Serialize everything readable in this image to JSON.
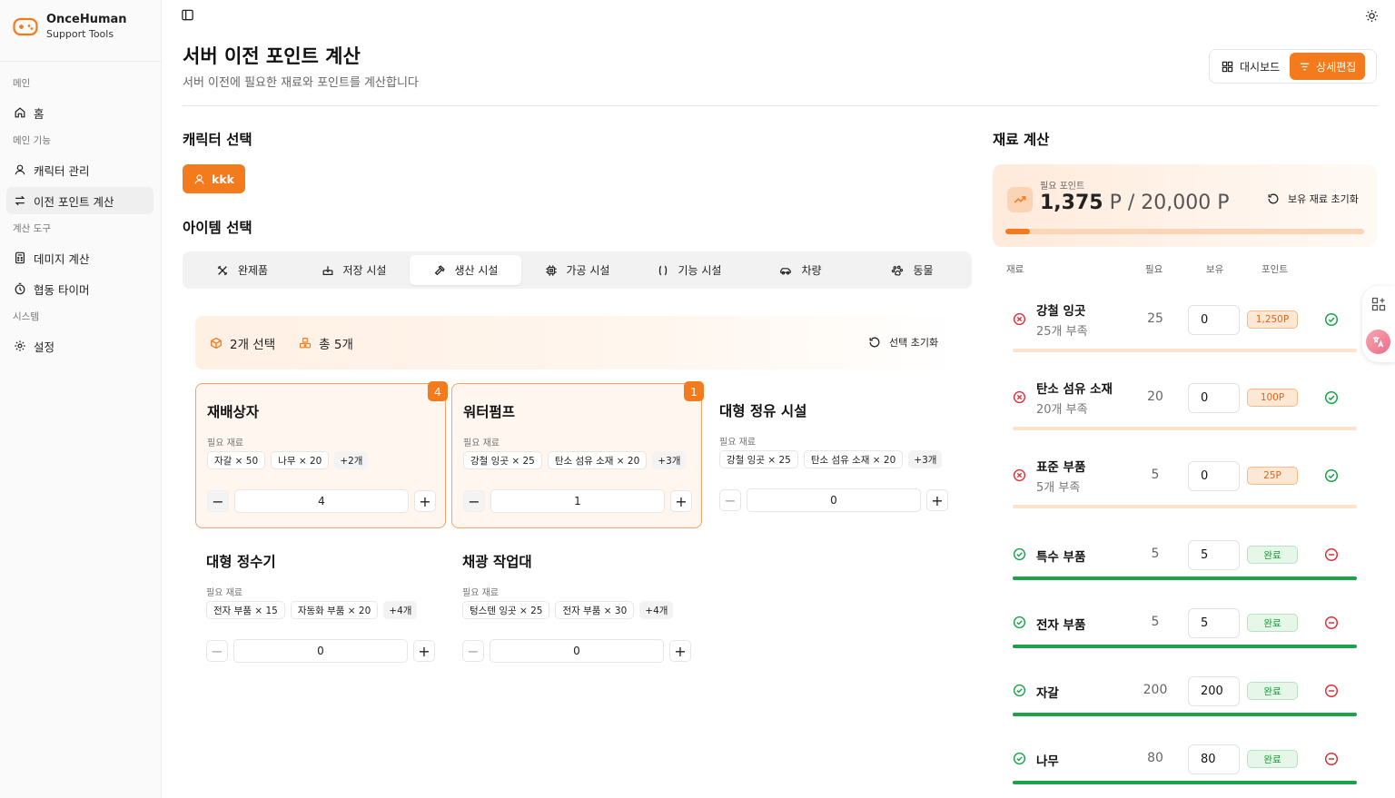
{
  "brand": {
    "name": "OnceHuman",
    "sub": "Support Tools"
  },
  "sidebar": {
    "groups": [
      "메인",
      "메인 기능",
      "계산 도구",
      "시스템"
    ],
    "items": [
      {
        "label": "홈",
        "icon": "home-icon"
      },
      {
        "label": "캐릭터 관리",
        "icon": "user-icon"
      },
      {
        "label": "이전 포인트 계산",
        "icon": "transfer-icon",
        "active": true
      },
      {
        "label": "데미지 계산",
        "icon": "calculator-icon"
      },
      {
        "label": "협동 타이머",
        "icon": "timer-icon"
      },
      {
        "label": "설정",
        "icon": "gear-icon"
      }
    ]
  },
  "header": {
    "title": "서버 이전 포인트 계산",
    "subtitle": "서버 이전에 필요한 재료와 포인트를 계산합니다",
    "dashboard_label": "대시보드",
    "detail_edit_label": "상세편집"
  },
  "character": {
    "section_title": "캐릭터 선택",
    "selected": "kkk"
  },
  "items_section": {
    "section_title": "아이템 선택",
    "tabs": [
      {
        "label": "완제품",
        "icon": "tools-icon"
      },
      {
        "label": "저장 시설",
        "icon": "storage-icon"
      },
      {
        "label": "생산 시설",
        "icon": "hammer-icon",
        "active": true
      },
      {
        "label": "가공 시설",
        "icon": "chip-icon"
      },
      {
        "label": "기능 시설",
        "icon": "brackets-icon"
      },
      {
        "label": "차량",
        "icon": "car-icon"
      },
      {
        "label": "동물",
        "icon": "paw-icon"
      }
    ],
    "summary": {
      "selected_text": "2개 선택",
      "total_text": "총 5개",
      "reset_label": "선택 초기화"
    },
    "req_label": "필요 재료",
    "cards": [
      {
        "name": "재배상자",
        "selected": true,
        "badge": "4",
        "materials": [
          "자갈 × 50",
          "나무 × 20"
        ],
        "more": "+2개",
        "qty": "4"
      },
      {
        "name": "워터펌프",
        "selected": true,
        "badge": "1",
        "materials": [
          "강철 잉곳 × 25",
          "탄소 섬유 소재 × 20"
        ],
        "more": "+3개",
        "qty": "1"
      },
      {
        "name": "대형 정유 시설",
        "selected": false,
        "badge": "",
        "materials": [
          "강철 잉곳 × 25",
          "탄소 섬유 소재 × 20"
        ],
        "more": "+3개",
        "qty": "0"
      },
      {
        "name": "대형 정수기",
        "selected": false,
        "badge": "",
        "materials": [
          "전자 부품 × 15",
          "자동화 부품 × 20"
        ],
        "more": "+4개",
        "qty": "0"
      },
      {
        "name": "채광 작업대",
        "selected": false,
        "badge": "",
        "materials": [
          "텅스텐 잉곳 × 25",
          "전자 부품 × 30"
        ],
        "more": "+4개",
        "qty": "0"
      }
    ]
  },
  "materials_panel": {
    "section_title": "재료 계산",
    "points_label": "필요 포인트",
    "points_current": "1,375",
    "points_sep": " P / ",
    "points_max": "20,000",
    "points_unit": " P",
    "points_fraction": 0.06875,
    "reset_label": "보유 재료 초기화",
    "headers": {
      "material": "재료",
      "need": "필요",
      "have": "보유",
      "points": "포인트"
    },
    "rows": [
      {
        "name": "강철 잉곳",
        "shortage": "25개 부족",
        "need": "25",
        "have": "0",
        "points": "1,250P",
        "status": "lack"
      },
      {
        "name": "탄소 섬유 소재",
        "shortage": "20개 부족",
        "need": "20",
        "have": "0",
        "points": "100P",
        "status": "lack"
      },
      {
        "name": "표준 부품",
        "shortage": "5개 부족",
        "need": "5",
        "have": "0",
        "points": "25P",
        "status": "lack"
      },
      {
        "name": "특수 부품",
        "shortage": "",
        "need": "5",
        "have": "5",
        "points": "완료",
        "status": "done"
      },
      {
        "name": "전자 부품",
        "shortage": "",
        "need": "5",
        "have": "5",
        "points": "완료",
        "status": "done"
      },
      {
        "name": "자갈",
        "shortage": "",
        "need": "200",
        "have": "200",
        "points": "완료",
        "status": "done"
      },
      {
        "name": "나무",
        "shortage": "",
        "need": "80",
        "have": "80",
        "points": "완료",
        "status": "done"
      }
    ]
  },
  "colors": {
    "accent": "#f47b1d",
    "success": "#1aa34a",
    "danger": "#e0303a"
  }
}
